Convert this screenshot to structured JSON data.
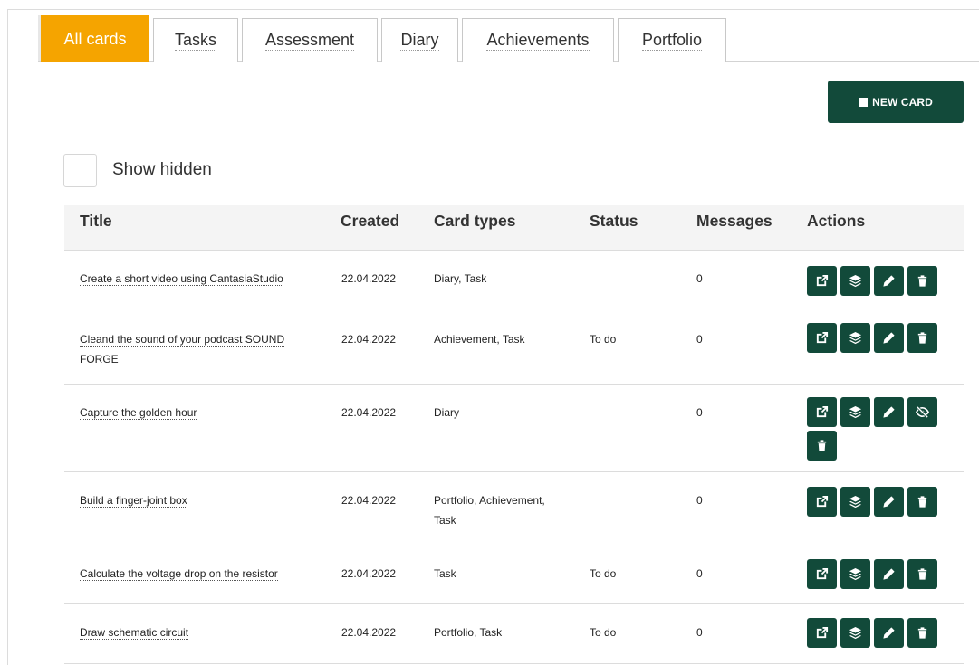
{
  "tabs": [
    {
      "label": "All cards",
      "active": true
    },
    {
      "label": "Tasks",
      "active": false
    },
    {
      "label": "Assessment",
      "active": false
    },
    {
      "label": "Diary",
      "active": false
    },
    {
      "label": "Achievements",
      "active": false
    },
    {
      "label": "Portfolio",
      "active": false
    }
  ],
  "toolbar": {
    "new_card_label": "NEW CARD",
    "new_card_icon": "square-icon"
  },
  "filter": {
    "show_hidden_label": "Show hidden",
    "show_hidden_checked": false
  },
  "table": {
    "headers": {
      "title": "Title",
      "created": "Created",
      "card_types": "Card types",
      "status": "Status",
      "messages": "Messages",
      "actions": "Actions"
    },
    "action_icons": [
      "external-link-icon",
      "layers-icon",
      "pencil-icon",
      "hide-icon",
      "trash-icon"
    ],
    "rows": [
      {
        "title": "Create a short video using CantasiaStudio",
        "created": "22.04.2022",
        "card_types": "Diary, Task",
        "status": "",
        "messages": "0",
        "actions": [
          "open",
          "layers",
          "edit",
          "delete"
        ]
      },
      {
        "title": "Cleand the sound of your podcast SOUND FORGE",
        "created": "22.04.2022",
        "card_types": "Achievement, Task",
        "status": "To do",
        "messages": "0",
        "actions": [
          "open",
          "layers",
          "edit",
          "delete"
        ]
      },
      {
        "title": "Capture the golden hour",
        "created": "22.04.2022",
        "card_types": "Diary",
        "status": "",
        "messages": "0",
        "actions": [
          "open",
          "layers",
          "edit",
          "hide",
          "delete"
        ]
      },
      {
        "title": "Build a finger-joint box",
        "created": "22.04.2022",
        "card_types": "Portfolio, Achievement, Task",
        "status": "",
        "messages": "0",
        "actions": [
          "open",
          "layers",
          "edit",
          "delete"
        ]
      },
      {
        "title": "Calculate the voltage drop on the resistor",
        "created": "22.04.2022",
        "card_types": "Task",
        "status": "To do",
        "messages": "0",
        "actions": [
          "open",
          "layers",
          "edit",
          "delete"
        ]
      },
      {
        "title": "Draw schematic circuit",
        "created": "22.04.2022",
        "card_types": "Portfolio, Task",
        "status": "To do",
        "messages": "0",
        "actions": [
          "open",
          "layers",
          "edit",
          "delete"
        ]
      }
    ]
  },
  "colors": {
    "accent": "#f5a400",
    "primary": "#124a3a",
    "header_bg": "#f4f4f4"
  }
}
